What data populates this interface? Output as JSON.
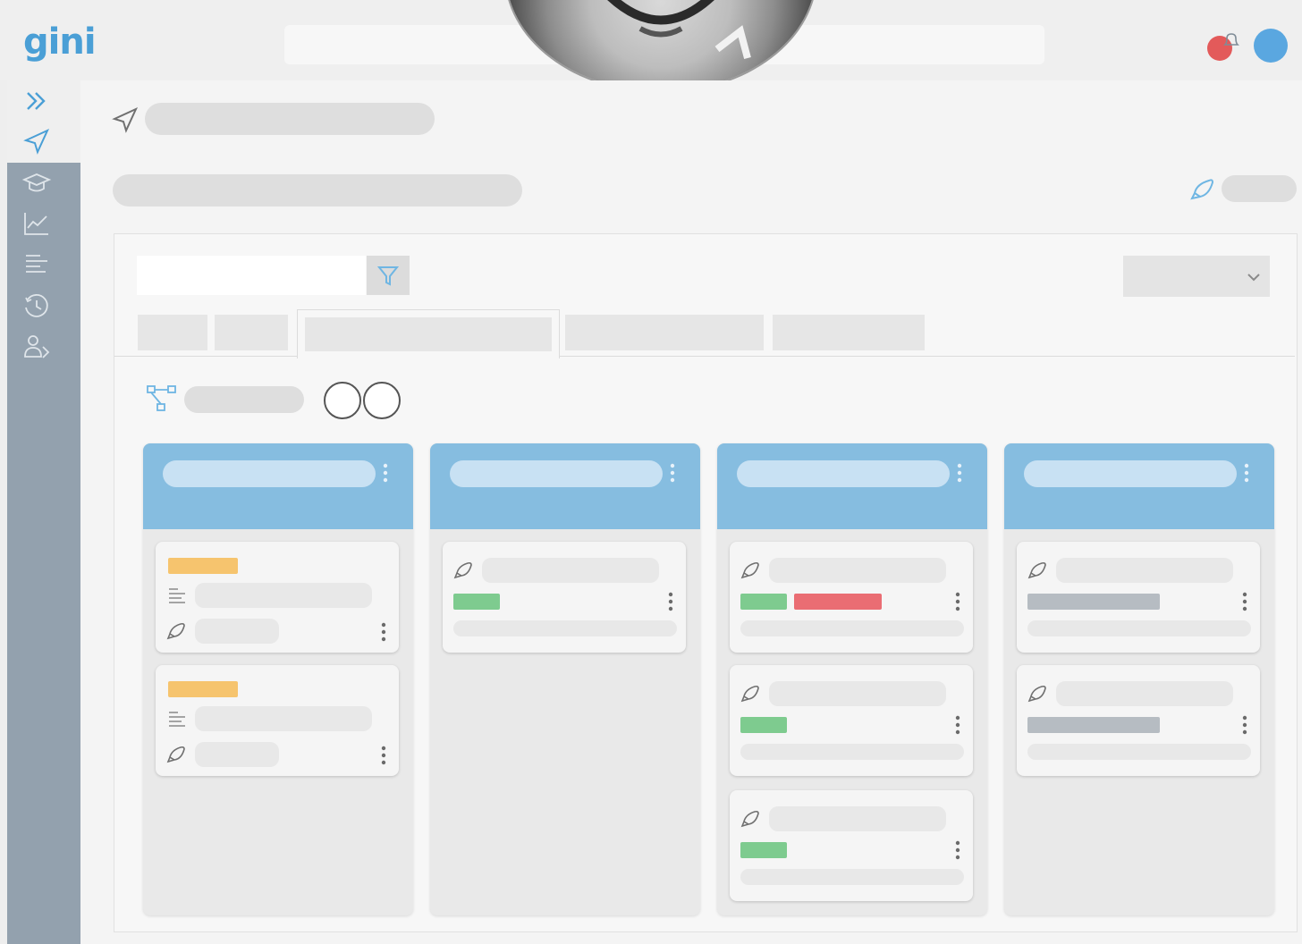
{
  "app": {
    "logo_text": "gini"
  },
  "colors": {
    "brand": "#4a9fd6",
    "sidebar": "#93a1ae",
    "column_header": "#86bde0",
    "tag_orange": "#f6c46e",
    "tag_green": "#7ecb8f",
    "tag_red": "#ea6d73",
    "tag_gray": "#b6bcc2",
    "notification": "#e35a5a",
    "profile": "#5aa7e0"
  },
  "sidebar": {
    "items": [
      {
        "icon": "double-chevron-right-icon"
      },
      {
        "icon": "send-icon"
      },
      {
        "icon": "graduation-cap-icon"
      },
      {
        "icon": "line-chart-icon"
      },
      {
        "icon": "text-align-left-icon"
      },
      {
        "icon": "history-icon"
      },
      {
        "icon": "users-icon"
      }
    ]
  },
  "toolbar": {
    "filter_icon": "filter-icon",
    "dropdown_icon": "chevron-down-icon",
    "tabs_count_visible": 5,
    "active_tab_index": 2
  },
  "board": {
    "columns": [
      {
        "cards": [
          {
            "tags": [
              "orange"
            ],
            "icons": [
              "list-icon",
              "rocket-icon"
            ]
          },
          {
            "tags": [
              "orange"
            ],
            "icons": [
              "list-icon",
              "rocket-icon"
            ]
          }
        ]
      },
      {
        "cards": [
          {
            "tags": [
              "green"
            ],
            "icons": [
              "rocket-icon"
            ]
          }
        ]
      },
      {
        "cards": [
          {
            "tags": [
              "green",
              "red"
            ],
            "icons": [
              "rocket-icon"
            ]
          },
          {
            "tags": [
              "green"
            ],
            "icons": [
              "rocket-icon"
            ]
          },
          {
            "tags": [
              "green"
            ],
            "icons": [
              "rocket-icon"
            ]
          }
        ]
      },
      {
        "cards": [
          {
            "tags": [
              "gray"
            ],
            "icons": [
              "rocket-icon"
            ]
          },
          {
            "tags": [
              "gray"
            ],
            "icons": [
              "rocket-icon"
            ]
          }
        ]
      }
    ]
  }
}
